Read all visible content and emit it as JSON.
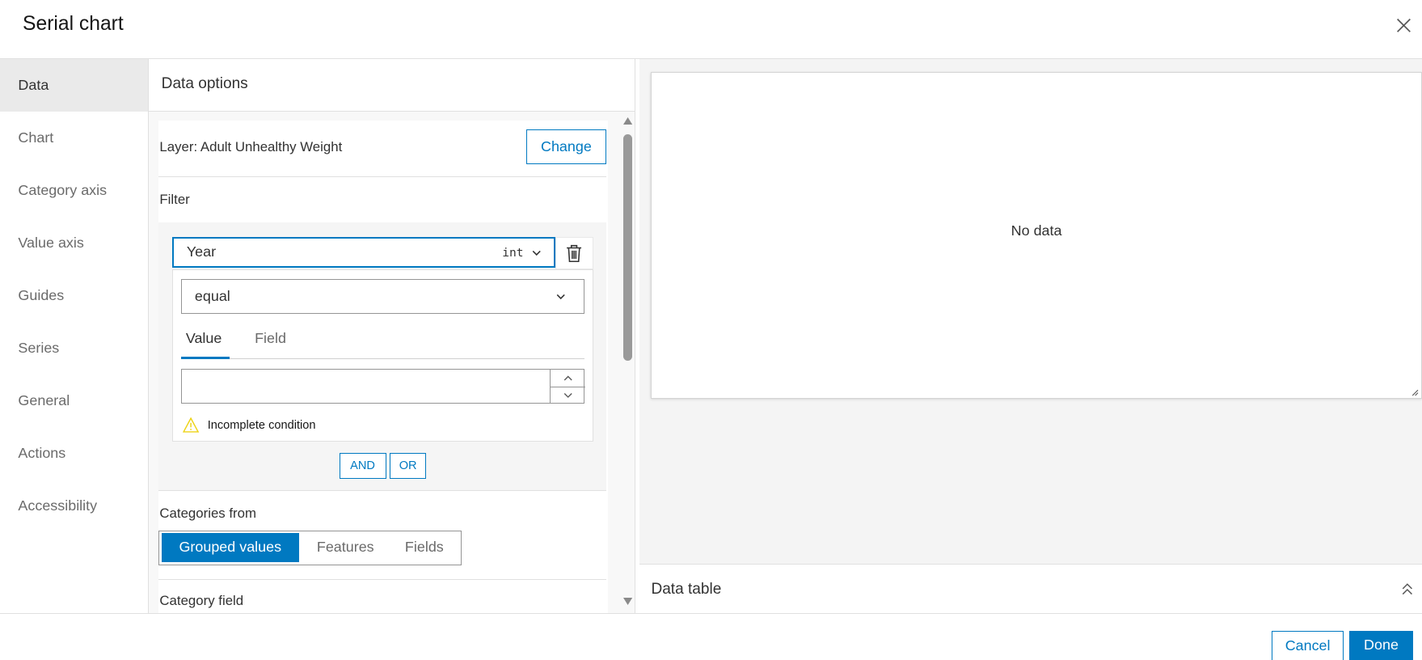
{
  "dialog": {
    "title": "Serial chart",
    "close_icon": "close-icon"
  },
  "nav": {
    "items": [
      {
        "label": "Data",
        "active": true
      },
      {
        "label": "Chart"
      },
      {
        "label": "Category axis"
      },
      {
        "label": "Value axis"
      },
      {
        "label": "Guides"
      },
      {
        "label": "Series"
      },
      {
        "label": "General"
      },
      {
        "label": "Actions"
      },
      {
        "label": "Accessibility"
      }
    ]
  },
  "data_options": {
    "title": "Data options",
    "layer_label": "Layer: Adult Unhealthy Weight",
    "change_label": "Change",
    "filter_label": "Filter",
    "filter": {
      "field": "Year",
      "field_type": "int",
      "operator": "equal",
      "tabs": [
        "Value",
        "Field"
      ],
      "active_tab": "Value",
      "value": "",
      "warning": "Incomplete condition",
      "and_label": "AND",
      "or_label": "OR"
    },
    "categories_from_label": "Categories from",
    "categories_from_options": [
      "Grouped values",
      "Features",
      "Fields"
    ],
    "categories_from_selected": "Grouped values",
    "category_field_label": "Category field"
  },
  "preview": {
    "empty_text": "No data",
    "data_table_label": "Data table"
  },
  "footer": {
    "cancel_label": "Cancel",
    "done_label": "Done"
  },
  "colors": {
    "accent": "#0079c1",
    "warning": "#edd317"
  }
}
